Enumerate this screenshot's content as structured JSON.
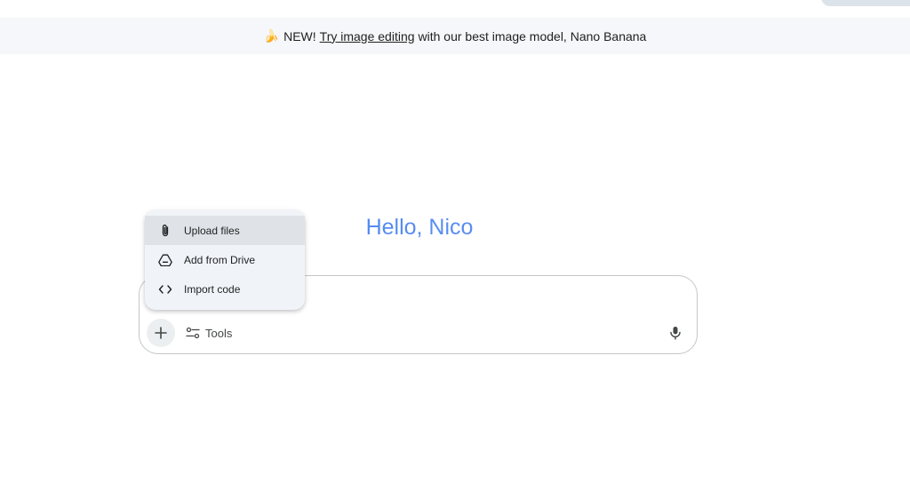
{
  "banner": {
    "emoji": "🍌",
    "new_label": "NEW!",
    "link_text": "Try image editing",
    "rest_text": "with our best image model, Nano Banana"
  },
  "greeting": "Hello, Nico",
  "upload_menu": {
    "items": [
      {
        "label": "Upload files",
        "icon": "paperclip-icon",
        "active": true
      },
      {
        "label": "Add from Drive",
        "icon": "drive-icon",
        "active": false
      },
      {
        "label": "Import code",
        "icon": "code-icon",
        "active": false
      }
    ]
  },
  "composer": {
    "tools_label": "Tools"
  },
  "colors": {
    "accent": "#4285f4",
    "banner_bg": "#f5f7fa",
    "menu_bg": "#f0f4f9"
  }
}
